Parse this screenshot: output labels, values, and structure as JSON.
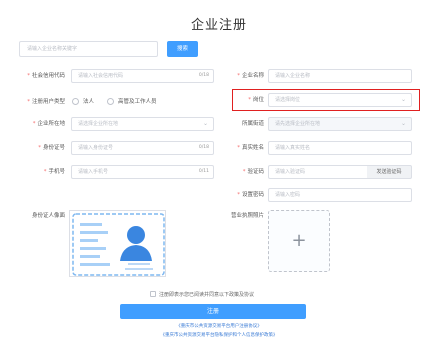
{
  "page": {
    "title": "企业注册"
  },
  "search": {
    "placeholder": "请输入企业名称关键字",
    "button_label": "搜索"
  },
  "form": {
    "credit_code": {
      "label": "社会信用代码",
      "placeholder": "请输入社会信用代码",
      "counter": "0/18"
    },
    "company_name": {
      "label": "企业名称",
      "placeholder": "请输入企业名称"
    },
    "user_type": {
      "label": "注册用户类型",
      "options": [
        "法人",
        "高管及工作人员"
      ]
    },
    "position": {
      "label": "岗位",
      "placeholder": "请选择岗位"
    },
    "location": {
      "label": "企业所在地",
      "placeholder": "请选择企业所在地"
    },
    "street": {
      "label": "所属街道",
      "placeholder": "请先选择企业所在地"
    },
    "id_number": {
      "label": "身份证号",
      "placeholder": "请输入身份证号",
      "counter": "0/18"
    },
    "real_name": {
      "label": "真实姓名",
      "placeholder": "请输入真实姓名"
    },
    "phone": {
      "label": "手机号",
      "placeholder": "请输入手机号",
      "counter": "0/11"
    },
    "verify_code": {
      "label": "验证码",
      "placeholder": "请输入验证码",
      "button_label": "发送验证码"
    },
    "password": {
      "label": "设置密码",
      "placeholder": "请输入密码"
    },
    "id_photo": {
      "label": "身份证人像面"
    },
    "license_photo": {
      "label": "营业执照照片"
    }
  },
  "agreement": {
    "text": "注册即表示您已阅读并同意以下政策及协议"
  },
  "register_button": {
    "label": "注册"
  },
  "links": [
    "《重庆市公共资源交易平台用户注册协议》",
    "《重庆市公共资源交易平台隐私保护和个人信息保护政策》"
  ],
  "colors": {
    "primary": "#409eff",
    "required": "#f56c6c",
    "highlight": "#e02020"
  }
}
